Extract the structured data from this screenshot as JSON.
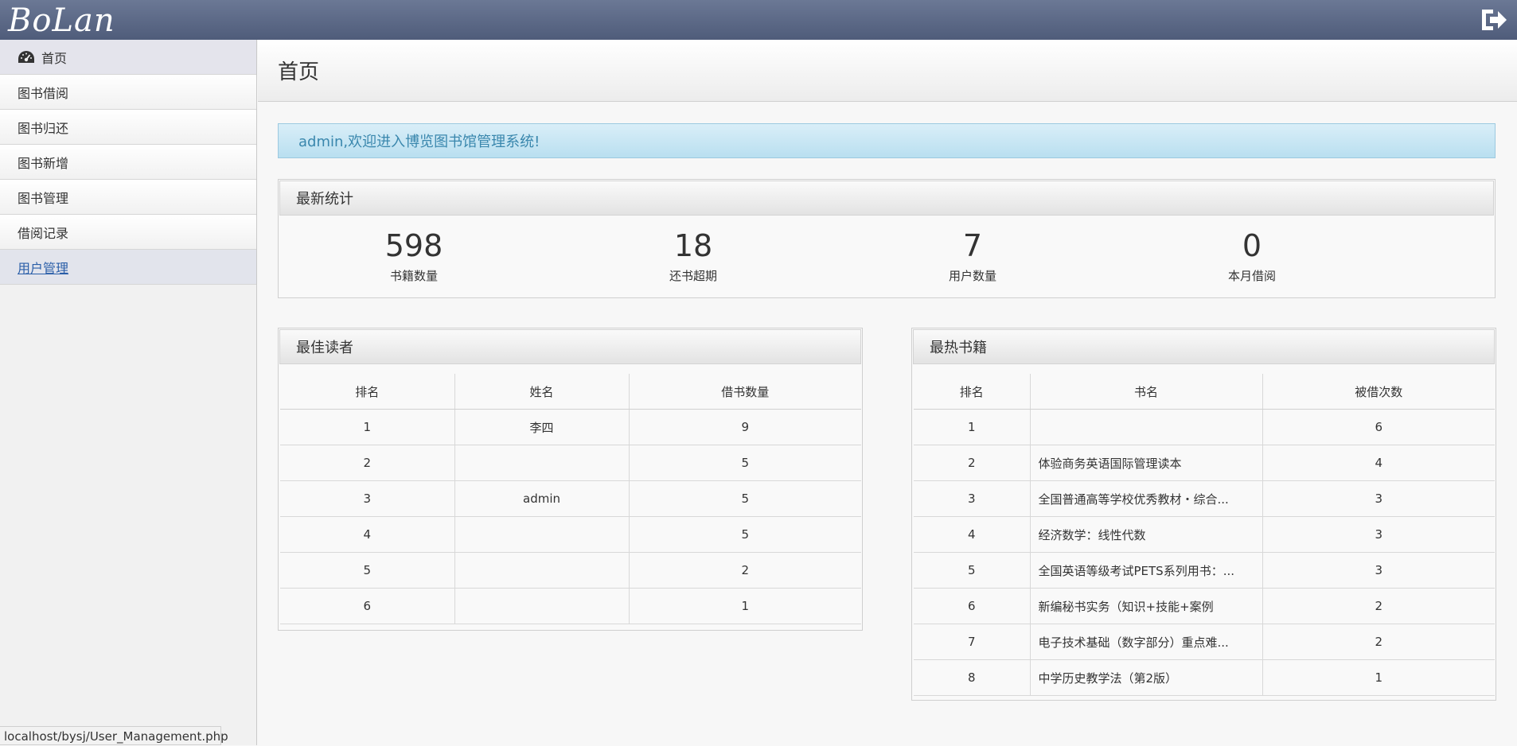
{
  "app": {
    "brand": "BoLan"
  },
  "sidebar": {
    "items": [
      {
        "label": "首页",
        "name": "sidebar-item-home",
        "icon": "dashboard-icon"
      },
      {
        "label": "图书借阅",
        "name": "sidebar-item-book-borrow"
      },
      {
        "label": "图书归还",
        "name": "sidebar-item-book-return"
      },
      {
        "label": "图书新增",
        "name": "sidebar-item-book-add"
      },
      {
        "label": "图书管理",
        "name": "sidebar-item-book-manage"
      },
      {
        "label": "借阅记录",
        "name": "sidebar-item-borrow-records"
      },
      {
        "label": "用户管理",
        "name": "sidebar-item-user-manage"
      }
    ]
  },
  "page": {
    "title": "首页",
    "welcome": "admin,欢迎进入博览图书馆管理系统!"
  },
  "stats": {
    "title": "最新统计",
    "items": [
      {
        "value": "598",
        "label": "书籍数量"
      },
      {
        "value": "18",
        "label": "还书超期"
      },
      {
        "value": "7",
        "label": "用户数量"
      },
      {
        "value": "0",
        "label": "本月借阅"
      }
    ]
  },
  "readers": {
    "title": "最佳读者",
    "columns": [
      "排名",
      "姓名",
      "借书数量"
    ],
    "rows": [
      [
        "1",
        "李四",
        "9"
      ],
      [
        "2",
        "",
        "5"
      ],
      [
        "3",
        "admin",
        "5"
      ],
      [
        "4",
        "",
        "5"
      ],
      [
        "5",
        "",
        "2"
      ],
      [
        "6",
        "",
        "1"
      ]
    ]
  },
  "books": {
    "title": "最热书籍",
    "columns": [
      "排名",
      "书名",
      "被借次数"
    ],
    "rows": [
      [
        "1",
        "",
        "6"
      ],
      [
        "2",
        "体验商务英语国际管理读本",
        "4"
      ],
      [
        "3",
        "全国普通高等学校优秀教材・综合...",
        "3"
      ],
      [
        "4",
        "经济数学：线性代数",
        "3"
      ],
      [
        "5",
        "全国英语等级考试PETS系列用书：...",
        "3"
      ],
      [
        "6",
        "新编秘书实务（知识+技能+案例",
        "2"
      ],
      [
        "7",
        "电子技术基础（数字部分）重点难...",
        "2"
      ],
      [
        "8",
        "中学历史教学法（第2版）",
        "1"
      ]
    ]
  },
  "statusbar": {
    "url": "localhost/bysj/User_Management.php"
  }
}
